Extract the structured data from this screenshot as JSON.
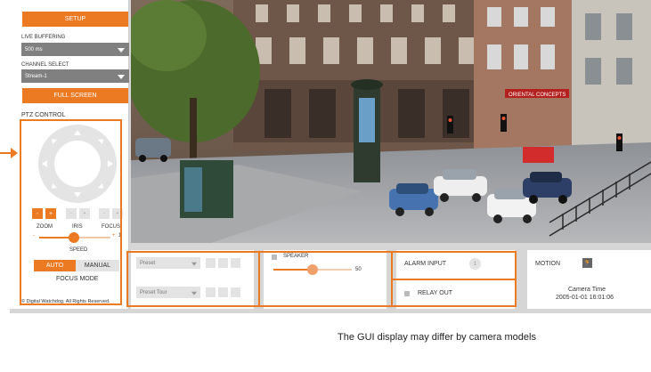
{
  "sidebar": {
    "setup_label": "SETUP",
    "live_buffering_label": "LIVE BUFFERING",
    "live_buffering_value": "500 ms",
    "channel_select_label": "CHANNEL SELECT",
    "channel_select_value": "Stream-1",
    "fullscreen_label": "FULL SCREEN",
    "ptz_label": "PTZ CONTROL",
    "zoom_label": "ZOOM",
    "iris_label": "IRIS",
    "focus_label": "FOCUS",
    "minus": "-",
    "plus": "+",
    "speed_label": "SPEED",
    "speed_value": "1",
    "auto_label": "AUTO",
    "manual_label": "MANUAL",
    "focus_mode_label": "FOCUS MODE",
    "copyright": "© Digital Watchdog. All Rights Reserved."
  },
  "video": {
    "storefront_sign": "ORIENTAL CONCEPTS"
  },
  "bottom": {
    "preset_value": "Preset",
    "preset_tour_value": "Preset Tour",
    "speaker_label": "SPEAKER",
    "speaker_value": "50",
    "alarm_input_label": "ALARM INPUT",
    "alarm_input_index": "1",
    "relay_out_label": "RELAY OUT",
    "motion_label": "MOTION",
    "camera_time_label": "Camera Time",
    "camera_time_value": "2005-01-01 16:01:06"
  },
  "caption": "The GUI display may differ by camera models",
  "colors": {
    "accent": "#ec7a23",
    "panel_grey": "#d6d6d6"
  }
}
